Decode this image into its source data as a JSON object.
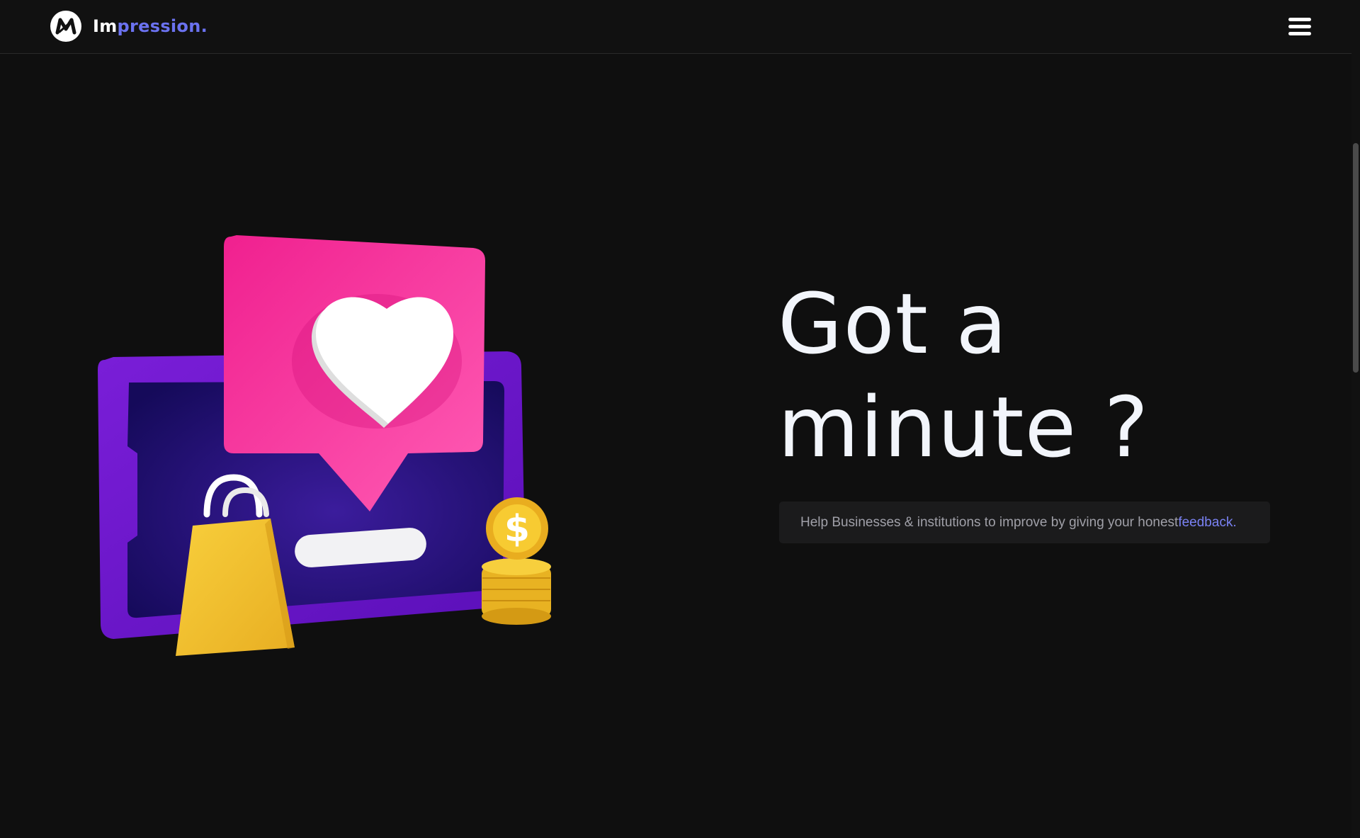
{
  "header": {
    "brand_prefix": "Im",
    "brand_suffix": "pression.",
    "logo_icon": "impression-logo-icon",
    "menu_icon": "hamburger-menu-icon"
  },
  "hero": {
    "headline_line1": "Got a",
    "headline_line2": "minute ?",
    "tagline_text": "Help Businesses & institutions to improve by giving your honest",
    "tagline_link": "feedback.",
    "illustration_icon": "feedback-illustration-icon"
  },
  "colors": {
    "background": "#0f0f0f",
    "navbar": "#111111",
    "accent": "#6b72f0",
    "headline": "#f2f5fb",
    "tagline_box": "#1b1b1c",
    "pink": "#f0208f",
    "purple": "#6a12c8",
    "gold": "#f0c030"
  }
}
